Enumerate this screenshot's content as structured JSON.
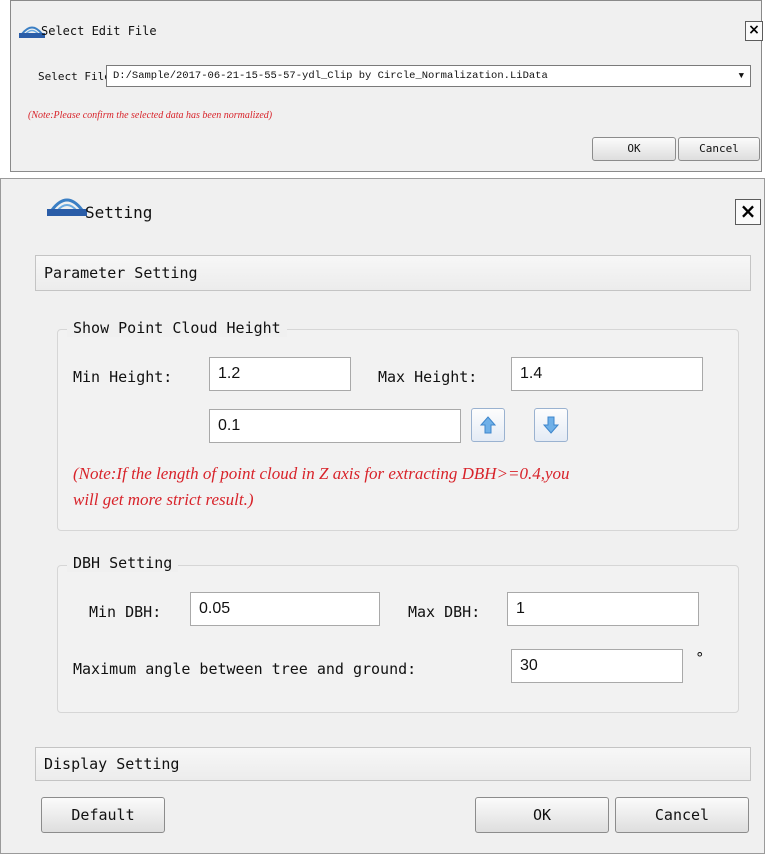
{
  "select_dialog": {
    "title": "Select Edit File",
    "close_glyph": "×",
    "select_file_label": "Select File:",
    "file_value": "D:/Sample/2017-06-21-15-55-57-ydl_Clip by Circle_Normalization.LiData",
    "note": "(Note:Please confirm the selected data has been normalized)",
    "ok_label": "OK",
    "cancel_label": "Cancel"
  },
  "setting_dialog": {
    "title": "Setting",
    "close_glyph": "×",
    "parameter_section": "Parameter Setting",
    "height_group": {
      "title": "Show Point Cloud Height",
      "min_label": "Min Height:",
      "min_value": "1.2",
      "max_label": "Max Height:",
      "max_value": "1.4",
      "step_value": "0.1",
      "note_line1": "(Note:If the length of point cloud in Z axis for extracting DBH>=0.4,you",
      "note_line2": "will get more strict result.)"
    },
    "dbh_group": {
      "title": "DBH Setting",
      "min_label": "Min DBH:",
      "min_value": "0.05",
      "max_label": "Max DBH:",
      "max_value": "1",
      "angle_label": "Maximum angle between tree and ground:",
      "angle_value": "30",
      "degree_symbol": "°"
    },
    "display_section": "Display Setting",
    "default_label": "Default",
    "ok_label": "OK",
    "cancel_label": "Cancel"
  },
  "icons": [
    "app-logo-icon",
    "close-icon",
    "arrow-up-icon",
    "arrow-down-icon",
    "dropdown-arrow-icon"
  ],
  "colors": {
    "note_red": "#d8232a",
    "dialog_bg": "#f0f0f0",
    "spin_arrow": "#5b9bd5"
  }
}
